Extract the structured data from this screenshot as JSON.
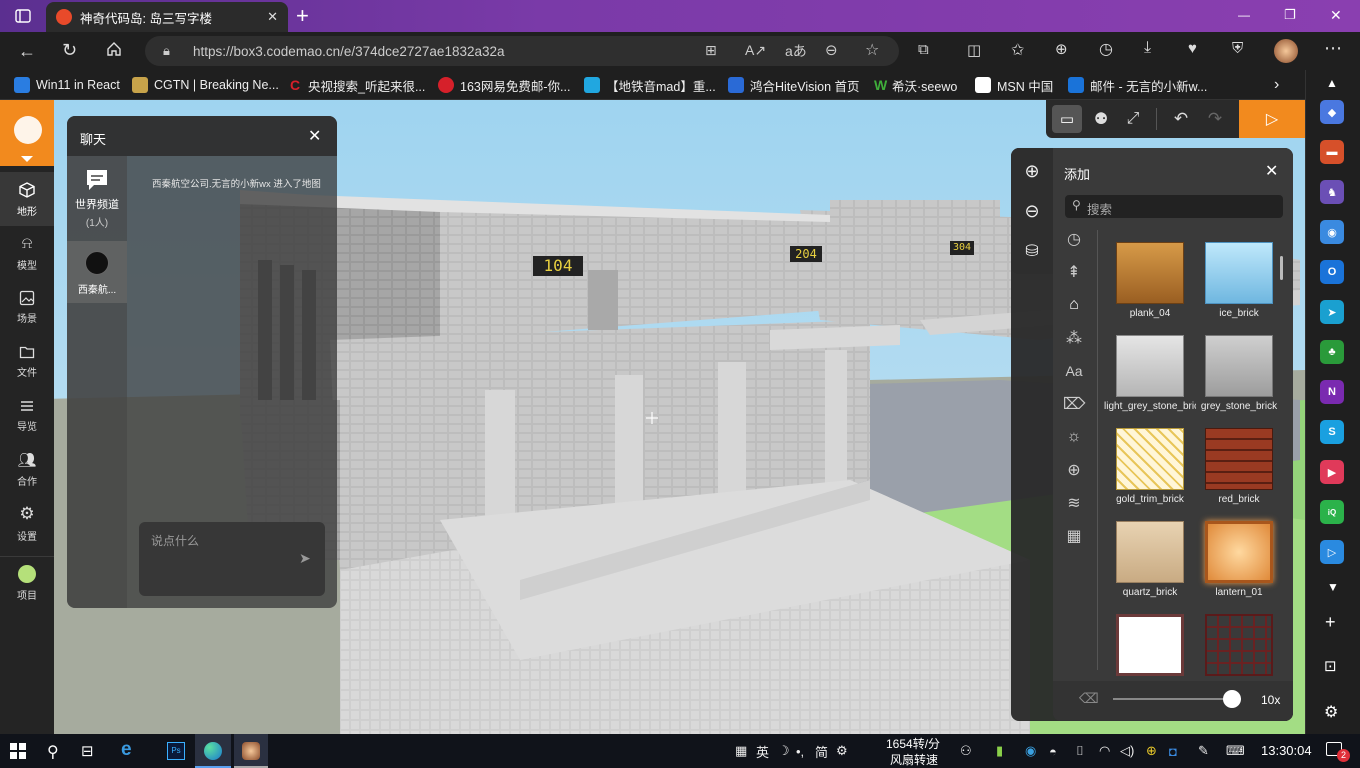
{
  "browser": {
    "tab_title": "神奇代码岛: 岛三写字楼",
    "new_tab": "+",
    "url": "https://box3.codemao.cn/e/374dce2727ae1832a32a",
    "window_controls": {
      "minimize": "—",
      "maximize": "❐",
      "close": "✕"
    }
  },
  "favorites": [
    {
      "label": "Win11 in React",
      "color": "#2a7de1"
    },
    {
      "label": "CGTN | Breaking Ne...",
      "color": "#c7a34a"
    },
    {
      "label": "央视搜索_听起来很...",
      "color": "#d6202a"
    },
    {
      "label": "163网易免费邮-你...",
      "color": "#d6202a"
    },
    {
      "label": "【地铁音mad】重...",
      "color": "#21a7e0"
    },
    {
      "label": "鸿合HiteVision 首页",
      "color": "#2a6ad6"
    },
    {
      "label": "希沃·seewo",
      "color": "#3fae3a"
    },
    {
      "label": "MSN 中国",
      "color": "#ffffff"
    },
    {
      "label": "邮件 - 无言的小新w...",
      "color": "#1a73d9"
    }
  ],
  "left_toolbar": [
    {
      "label": "地形",
      "icon": "cube-icon",
      "active": true
    },
    {
      "label": "模型",
      "icon": "bell-icon"
    },
    {
      "label": "场景",
      "icon": "image-icon"
    },
    {
      "label": "文件",
      "icon": "folder-icon"
    },
    {
      "label": "导览",
      "icon": "list-icon"
    },
    {
      "label": "合作",
      "icon": "users-icon"
    },
    {
      "label": "设置",
      "icon": "gear-icon"
    },
    {
      "label": "项目",
      "icon": "project-icon"
    }
  ],
  "chat": {
    "title": "聊天",
    "channel_name": "世界频道",
    "channel_count": "(1人)",
    "user_channel": "西秦航...",
    "system_message": "西秦航空公司.无言的小新wx 进入了地图",
    "input_placeholder": "说点什么"
  },
  "scene_labels": [
    "104",
    "204",
    "304"
  ],
  "top_toolbar": {
    "icons": [
      "chat-icon",
      "bug-icon",
      "resize-icon",
      "undo-icon",
      "redo-icon",
      "play-icon"
    ]
  },
  "add_panel": {
    "title": "添加",
    "search_placeholder": "搜索",
    "blocks": [
      {
        "name": "plank_04"
      },
      {
        "name": "ice_brick"
      },
      {
        "name": "light_grey_stone_brick"
      },
      {
        "name": "grey_stone_brick"
      },
      {
        "name": "gold_trim_brick"
      },
      {
        "name": "red_brick"
      },
      {
        "name": "quartz_brick"
      },
      {
        "name": "lantern_01"
      },
      {
        "name": ""
      },
      {
        "name": ""
      }
    ],
    "zoom_label": "10x",
    "slider_value": 1.0
  },
  "taskbar": {
    "ime": [
      "英",
      "简"
    ],
    "fan_speed": "1654转/分",
    "fan_label": "风扇转速",
    "clock": "13:30:04",
    "notif_count": "2"
  },
  "edge_sidebar_icons": [
    "tag-icon",
    "toolbox-icon",
    "chess-icon",
    "copilot-icon",
    "outlook-icon",
    "send-icon",
    "tree-icon",
    "onenote-icon",
    "skype-icon",
    "youku-icon",
    "iqiyi-icon",
    "video-icon"
  ]
}
